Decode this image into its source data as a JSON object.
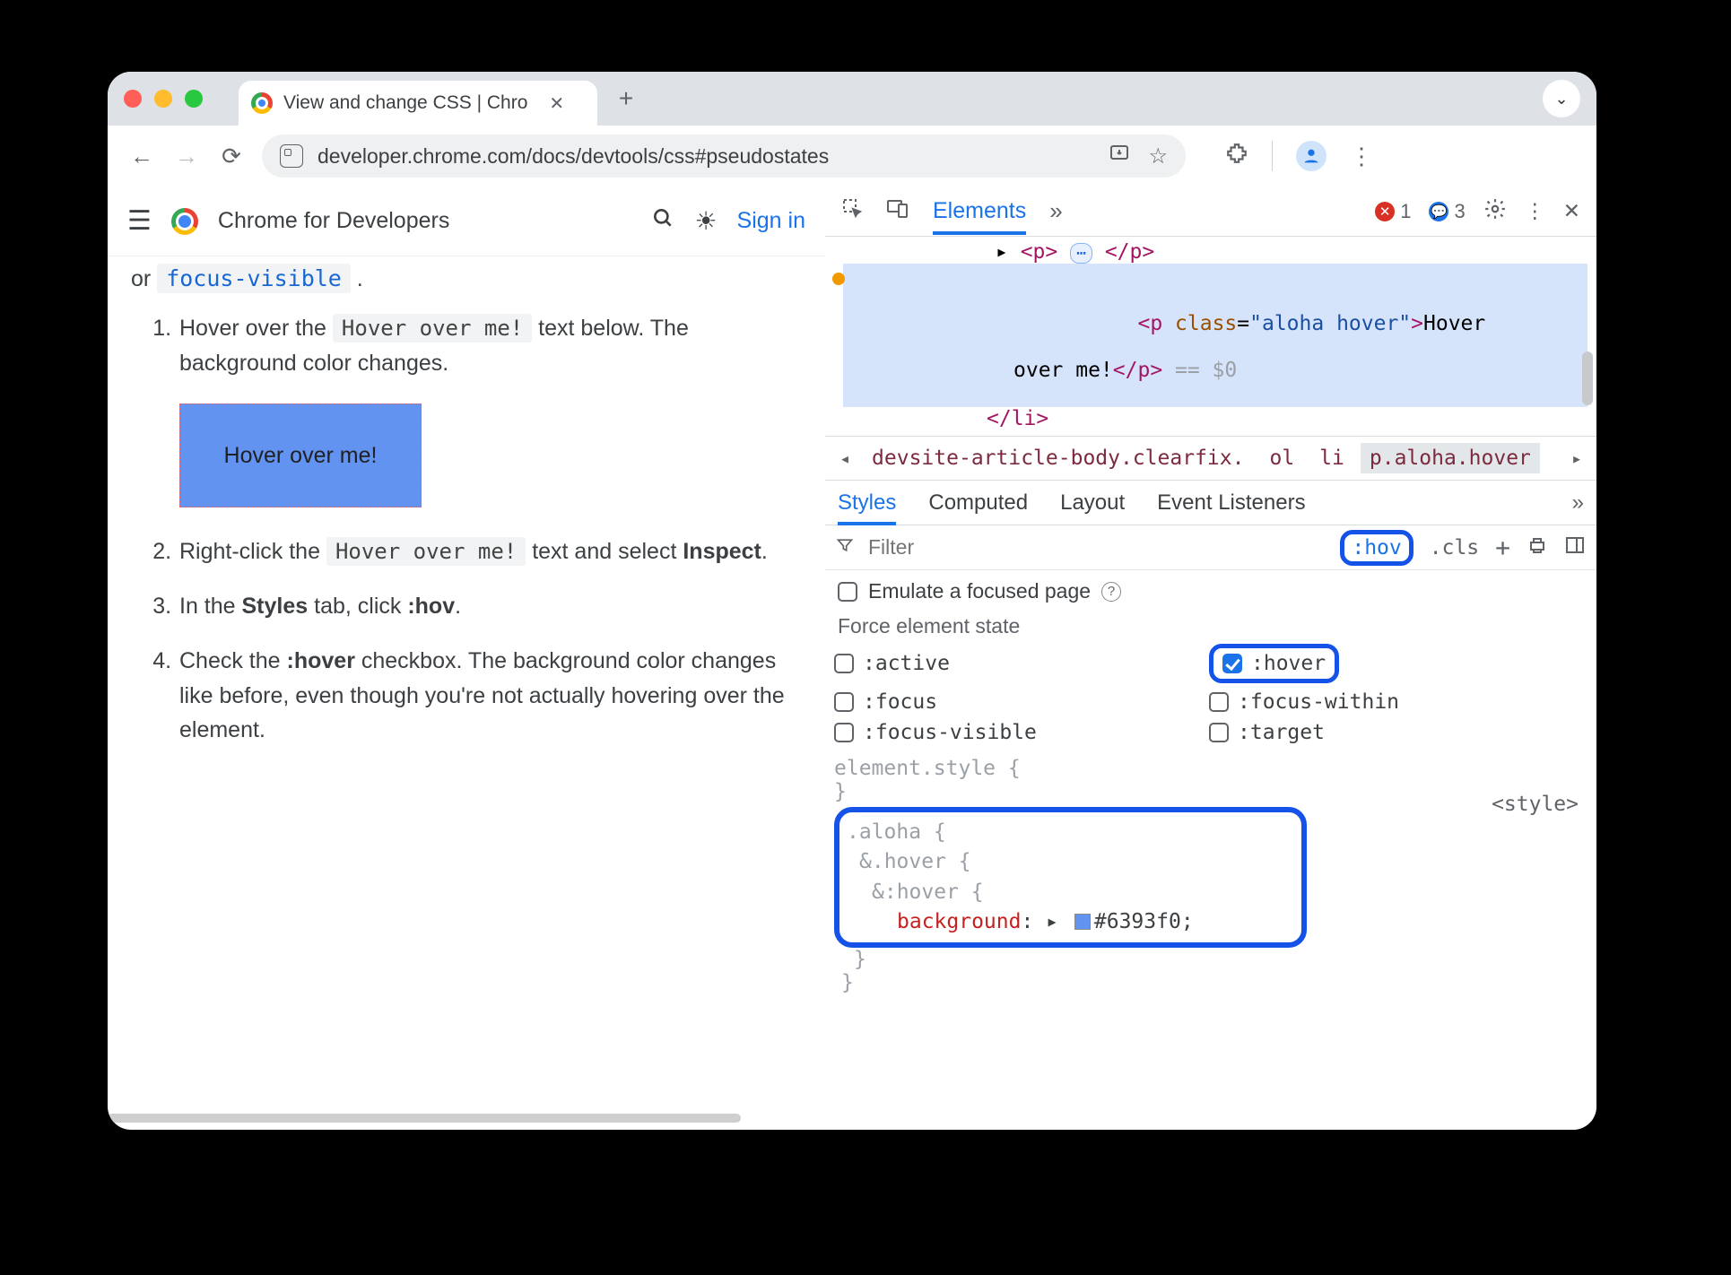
{
  "browser": {
    "tab_title": "View and change CSS  |  Chro",
    "url": "developer.chrome.com/docs/devtools/css#pseudostates"
  },
  "page": {
    "brand": "Chrome for Developers",
    "sign_in": "Sign in",
    "intro_or": "or ",
    "intro_code": "focus-visible",
    "intro_period": " .",
    "steps": {
      "s1a": "Hover over the ",
      "s1code": "Hover over me!",
      "s1b": " text below. The background color changes.",
      "hoverbox": "Hover over me!",
      "s2a": "Right-click the ",
      "s2code": "Hover over me!",
      "s2b": " text and select ",
      "s2bold": "Inspect",
      "s2c": ".",
      "s3a": "In the ",
      "s3bold1": "Styles",
      "s3b": " tab, click ",
      "s3bold2": ":hov",
      "s3c": ".",
      "s4a": "Check the ",
      "s4bold": ":hover",
      "s4b": " checkbox. The background color changes like before, even though you're not actually hovering over the element."
    }
  },
  "devtools": {
    "tab_elements": "Elements",
    "errors": "1",
    "issues": "3",
    "dom": {
      "l1_a": "▸ ",
      "p_open": "<p>",
      "p_close": "</p>",
      "sel_open": "<p ",
      "sel_attr": "class",
      "sel_val": "\"aloha hover\"",
      "sel_gt": ">",
      "sel_text1": "Hover",
      "sel_text2": "over me!",
      "sel_close": "</p>",
      "sel_eq": " == $0",
      "li_close": "</li>"
    },
    "crumbs": {
      "c1": "devsite-article-body.clearfix.",
      "c2": "ol",
      "c3": "li",
      "c4": "p.aloha.hover"
    },
    "subtabs": {
      "styles": "Styles",
      "computed": "Computed",
      "layout": "Layout",
      "events": "Event Listeners"
    },
    "filter": {
      "placeholder": "Filter",
      "hov": ":hov",
      "cls": ".cls"
    },
    "emulate": "Emulate a focused page",
    "force_header": "Force element state",
    "states": {
      "active": ":active",
      "hover": ":hover",
      "focus": ":focus",
      "focus_within": ":focus-within",
      "focus_visible": ":focus-visible",
      "target": ":target"
    },
    "rules": {
      "elstyle": "element.style {",
      "brace": "}",
      "aloha": ".aloha {",
      "hoverclass": "&.hover {",
      "hoverpseudo": "&:hover {",
      "prop": "background",
      "colon": ": ▸ ",
      "value": "#6393f0",
      "semi": ";",
      "source": "<style>"
    }
  }
}
